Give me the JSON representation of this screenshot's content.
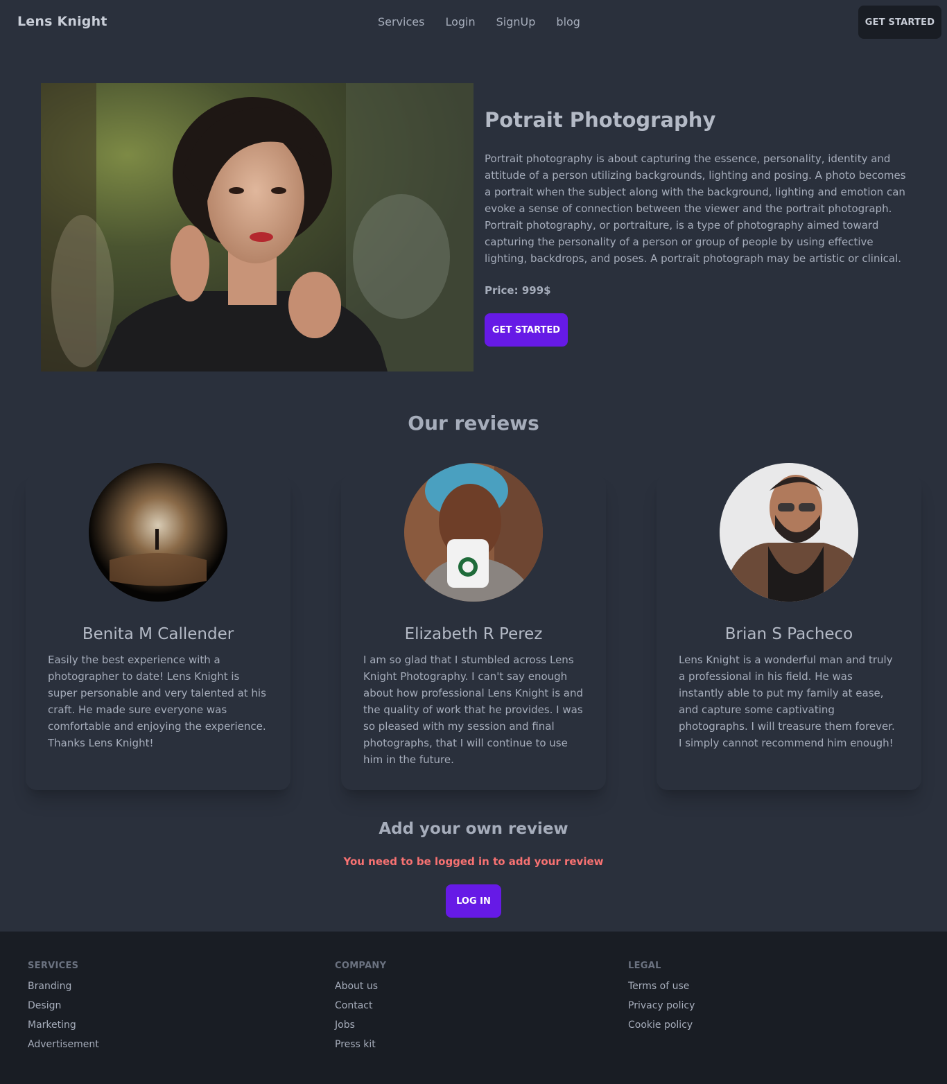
{
  "navbar": {
    "brand": "Lens Knight",
    "links": [
      "Services",
      "Login",
      "SignUp",
      "blog"
    ],
    "cta": "GET STARTED"
  },
  "hero": {
    "title": "Potrait Photography",
    "description": "Portrait photography is about capturing the essence, personality, identity and attitude of a person utilizing backgrounds, lighting and posing. A photo becomes a portrait when the subject along with the background, lighting and emotion can evoke a sense of connection between the viewer and the portrait photograph. Portrait photography, or portraiture, is a type of photography aimed toward capturing the personality of a person or group of people by using effective lighting, backdrops, and poses. A portrait photograph may be artistic or clinical.",
    "price": "Price: 999$",
    "cta": "GET STARTED"
  },
  "reviews": {
    "title": "Our reviews",
    "items": [
      {
        "name": "Benita M Callender",
        "text": "Easily the best experience with a photographer to date! Lens Knight is super personable and very talented at his craft. He made sure everyone was comfortable and enjoying the experience. Thanks Lens Knight!"
      },
      {
        "name": "Elizabeth R Perez",
        "text": "I am so glad that I stumbled across Lens Knight Photography. I can't say enough about how professional Lens Knight is and the quality of work that he provides. I was so pleased with my session and final photographs, that I will continue to use him in the future."
      },
      {
        "name": "Brian S Pacheco",
        "text": "Lens Knight is a wonderful man and truly a professional in his field. He was instantly able to put my family at ease, and capture some captivating photographs. I will treasure them forever. I simply cannot recommend him enough!"
      }
    ]
  },
  "add_review": {
    "title": "Add your own review",
    "warning": "You need to be logged in to add your review",
    "login": "LOG IN"
  },
  "footer": {
    "services": {
      "heading": "SERVICES",
      "links": [
        "Branding",
        "Design",
        "Marketing",
        "Advertisement"
      ]
    },
    "company": {
      "heading": "COMPANY",
      "links": [
        "About us",
        "Contact",
        "Jobs",
        "Press kit"
      ]
    },
    "legal": {
      "heading": "LEGAL",
      "links": [
        "Terms of use",
        "Privacy policy",
        "Cookie policy"
      ]
    }
  },
  "colors": {
    "background": "#2a303c",
    "footer": "#191d24",
    "primary": "#661ae6",
    "warning": "#f87272"
  }
}
